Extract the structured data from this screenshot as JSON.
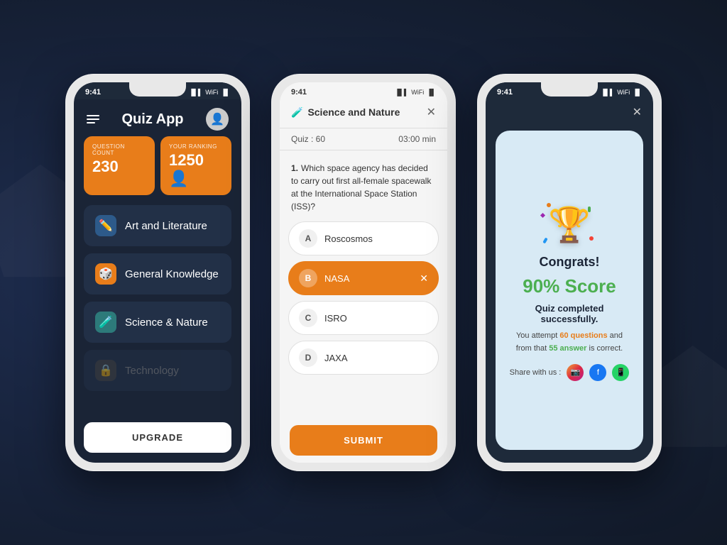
{
  "background": "#1a2340",
  "phone1": {
    "status_time": "9:41",
    "header": {
      "title": "Quiz App"
    },
    "stats": [
      {
        "label": "Question Count",
        "value": "230"
      },
      {
        "label": "Your Ranking",
        "value": "1250"
      }
    ],
    "categories": [
      {
        "name": "Art and Literature",
        "icon": "✏️",
        "icon_class": "blue",
        "locked": false
      },
      {
        "name": "General Knowledge",
        "icon": "🎲",
        "icon_class": "orange",
        "locked": false
      },
      {
        "name": "Science & Nature",
        "icon": "🧪",
        "icon_class": "teal",
        "locked": false
      },
      {
        "name": "Technology",
        "icon": "🔒",
        "icon_class": "gray",
        "locked": true
      }
    ],
    "upgrade_label": "UPGRADE"
  },
  "phone2": {
    "status_time": "9:41",
    "category": "Science and Nature",
    "quiz_count_label": "Quiz : 60",
    "timer_label": "03:00 min",
    "question_num": "1.",
    "question": "Which space agency has decided to carry out first all-female spacewalk at the International Space Station (ISS)?",
    "options": [
      {
        "letter": "A",
        "text": "Roscosmos",
        "selected": false
      },
      {
        "letter": "B",
        "text": "NASA",
        "selected": true
      },
      {
        "letter": "C",
        "text": "ISRO",
        "selected": false
      },
      {
        "letter": "D",
        "text": "JAXA",
        "selected": false
      }
    ],
    "submit_label": "SUBMIT"
  },
  "phone3": {
    "status_time": "9:41",
    "congrats": "Congrats!",
    "score": "90% Score",
    "success": "Quiz completed successfully.",
    "attempt_text_1": "You attempt",
    "questions_count": "60 questions",
    "attempt_text_2": "and",
    "attempt_text_3": "from that",
    "answers_count": "55 answer",
    "attempt_text_4": "is correct.",
    "share_label": "Share with us :"
  }
}
